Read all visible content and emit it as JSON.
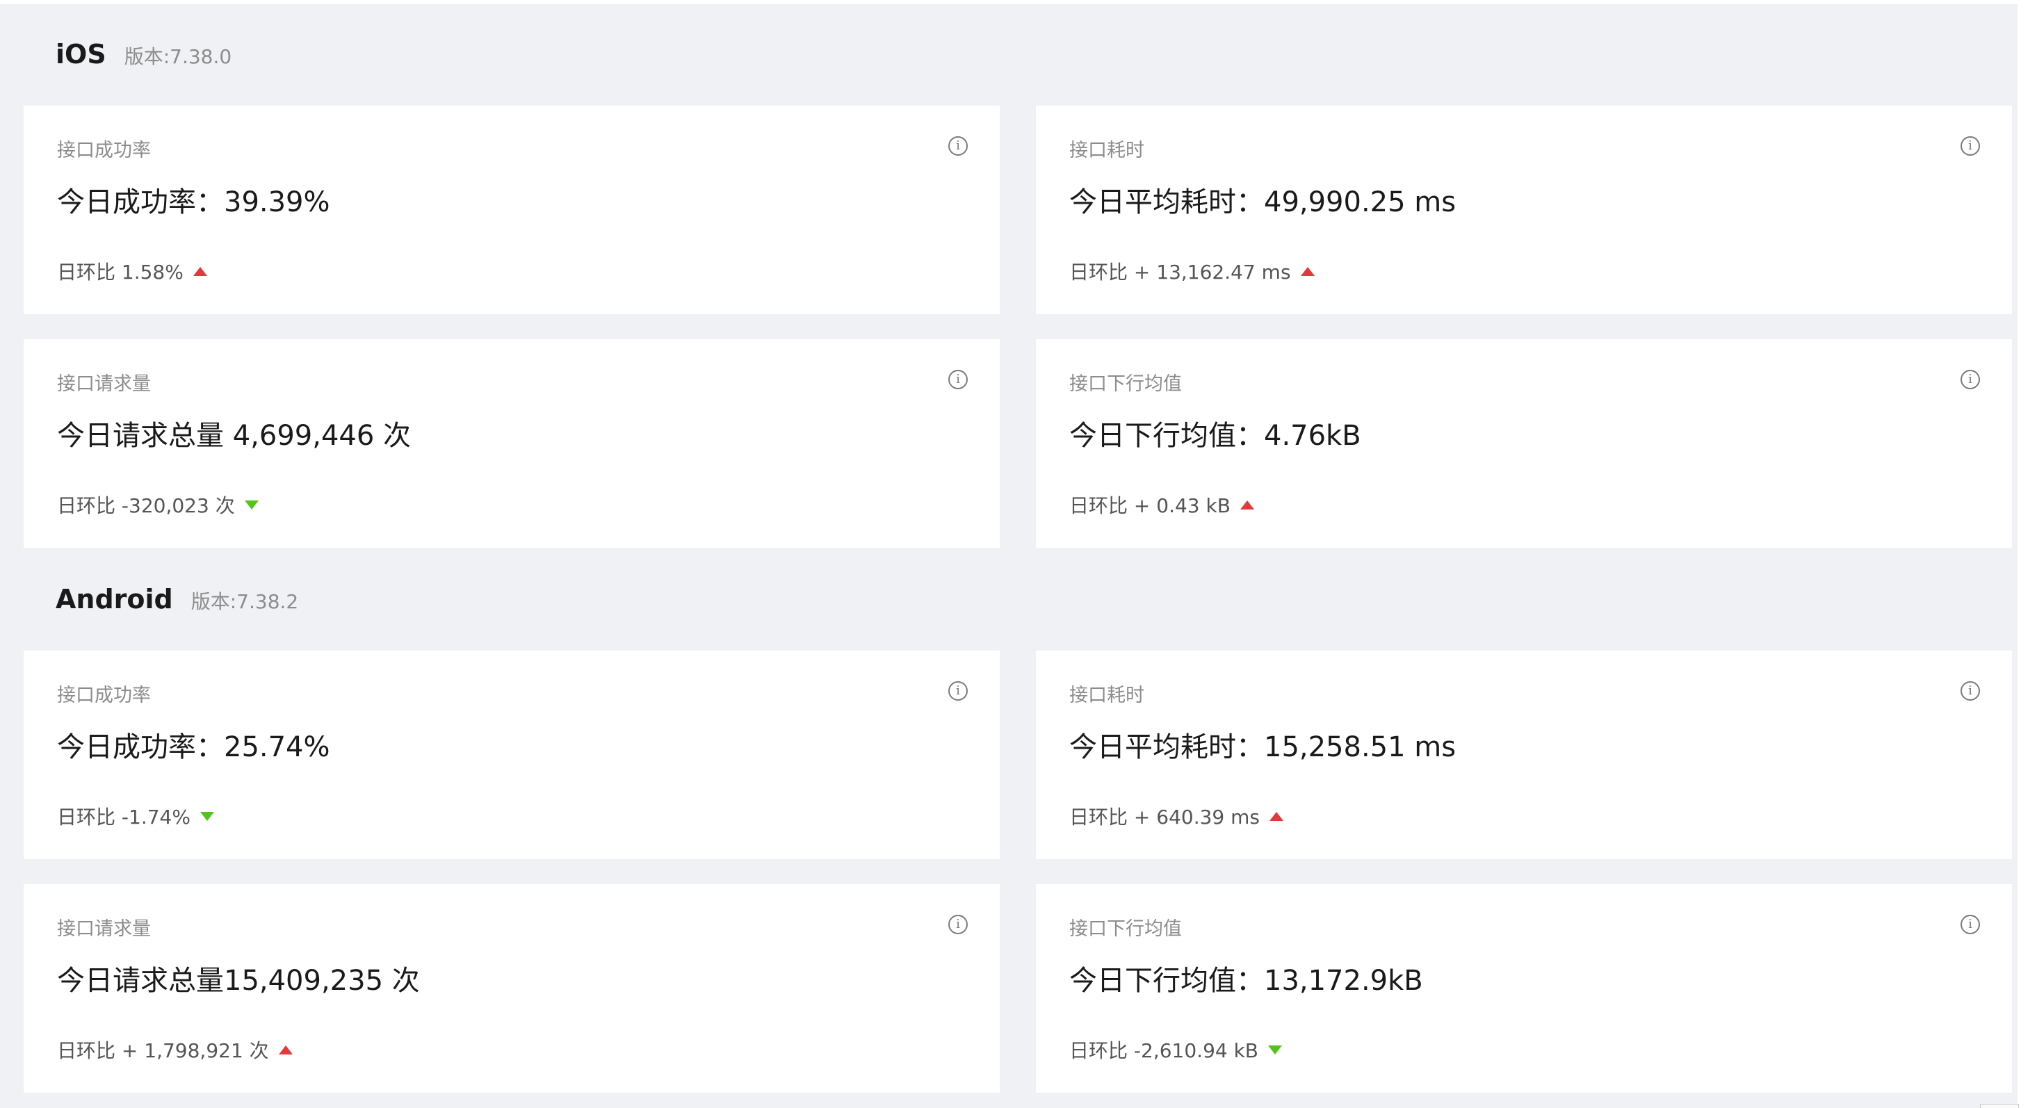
{
  "sections": [
    {
      "platform": "iOS",
      "version": "版本:7.38.0",
      "cards": [
        {
          "title": "接口成功率",
          "main": "今日成功率：39.39%",
          "compare": "日环比 1.58%",
          "trend": "up"
        },
        {
          "title": "接口耗时",
          "main": "今日平均耗时：49,990.25 ms",
          "compare": "日环比 + 13,162.47 ms",
          "trend": "up"
        },
        {
          "title": "接口请求量",
          "main": "今日请求总量 4,699,446 次",
          "compare": "日环比 -320,023 次",
          "trend": "down"
        },
        {
          "title": "接口下行均值",
          "main": "今日下行均值：4.76kB",
          "compare": "日环比 + 0.43 kB",
          "trend": "up"
        }
      ]
    },
    {
      "platform": "Android",
      "version": "版本:7.38.2",
      "cards": [
        {
          "title": "接口成功率",
          "main": "今日成功率：25.74%",
          "compare": "日环比 -1.74%",
          "trend": "down"
        },
        {
          "title": "接口耗时",
          "main": "今日平均耗时：15,258.51 ms",
          "compare": "日环比 + 640.39 ms",
          "trend": "up"
        },
        {
          "title": "接口请求量",
          "main": "今日请求总量15,409,235 次",
          "compare": "日环比 + 1,798,921 次",
          "trend": "up"
        },
        {
          "title": "接口下行均值",
          "main": "今日下行均值：13,172.9kB",
          "compare": "日环比 -2,610.94 kB",
          "trend": "down"
        }
      ]
    }
  ],
  "icons": {
    "info": "info-icon",
    "trend_up": "arrow-up-icon",
    "trend_down": "arrow-down-icon"
  },
  "colors": {
    "up": "#e5383b",
    "down": "#52c41a",
    "background": "#f0f1f5"
  }
}
